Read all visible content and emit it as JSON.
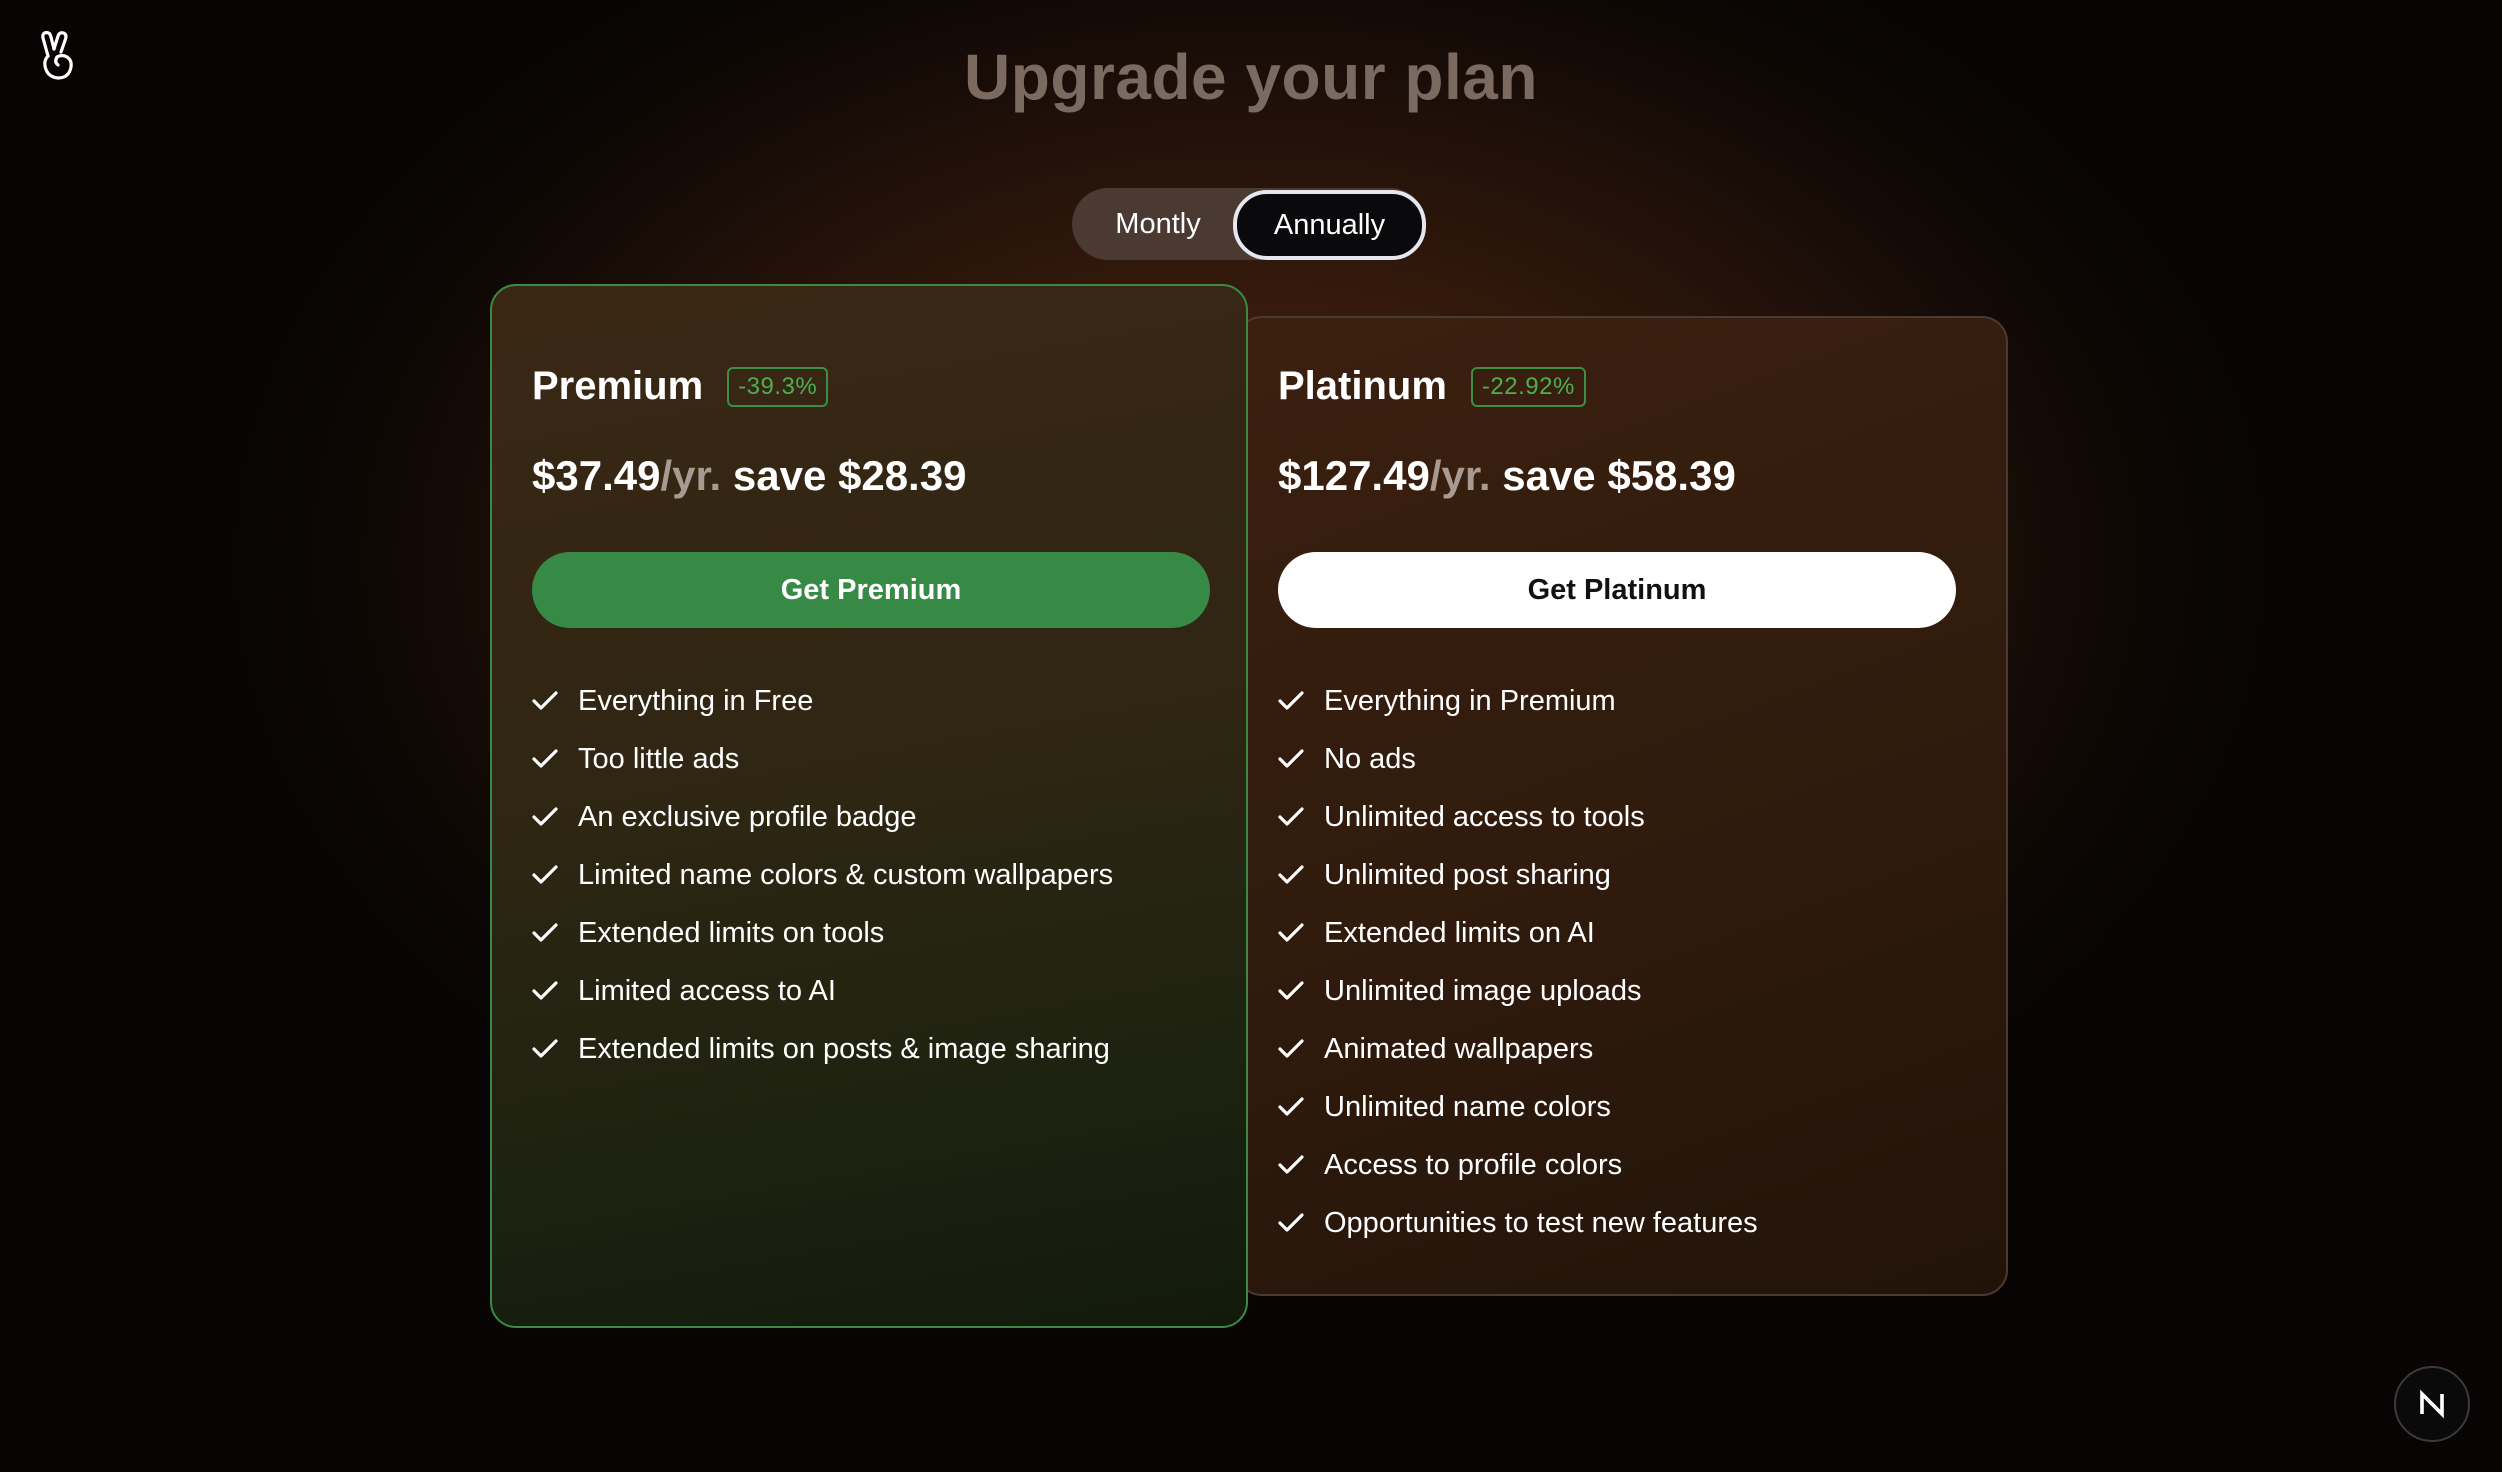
{
  "page": {
    "title": "Upgrade your plan"
  },
  "billing_toggle": {
    "monthly": "Montly",
    "annually": "Annually",
    "selected": "Annually"
  },
  "plans": [
    {
      "name": "Premium",
      "discount": "-39.3%",
      "price": "$37.49",
      "period": "/yr.",
      "save": "save $28.39",
      "cta": "Get Premium",
      "features": [
        "Everything in Free",
        "Too little ads",
        "An exclusive profile badge",
        "Limited name colors & custom wallpapers",
        "Extended limits on tools",
        "Limited access to AI",
        "Extended limits on posts & image sharing"
      ]
    },
    {
      "name": "Platinum",
      "discount": "-22.92%",
      "price": "$127.49",
      "period": "/yr.",
      "save": "save $58.39",
      "cta": "Get Platinum",
      "features": [
        "Everything in Premium",
        "No ads",
        "Unlimited access to tools",
        "Unlimited post sharing",
        "Extended limits on AI",
        "Unlimited image uploads",
        "Animated wallpapers",
        "Unlimited name colors",
        "Access to profile colors",
        "Opportunities to test new features"
      ]
    }
  ],
  "corner_button": {
    "label": "N",
    "icon": "nextjs-icon"
  },
  "logo": {
    "icon": "peace-hand-icon"
  },
  "colors": {
    "accent_green": "#378a45",
    "badge_green": "#4caf50",
    "title": "#7a6a60",
    "price_period": "#a89a90"
  }
}
